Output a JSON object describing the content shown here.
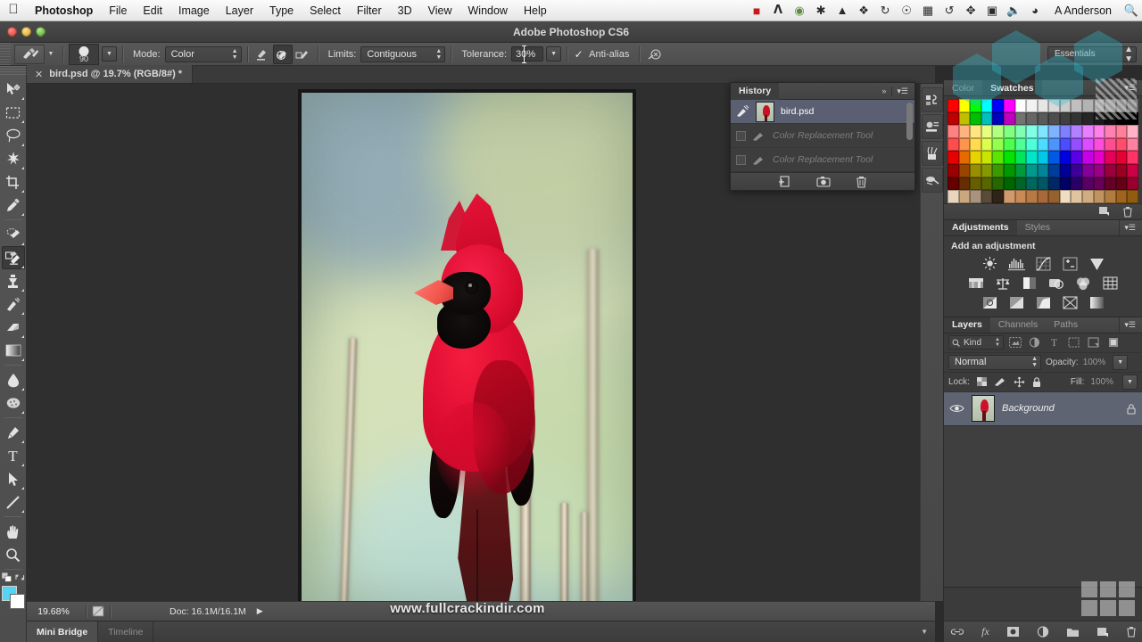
{
  "macbar": {
    "apple_icon": "apple-icon",
    "menus": [
      "Photoshop",
      "File",
      "Edit",
      "Image",
      "Layer",
      "Type",
      "Select",
      "Filter",
      "3D",
      "View",
      "Window",
      "Help"
    ],
    "status_icons": [
      "film-icon",
      "adobe-icon",
      "globe-icon",
      "asterisk-icon",
      "bell-icon",
      "dropbox-icon",
      "sync-icon",
      "accessibility-icon",
      "display-icon",
      "timemachine-icon",
      "bluetooth-icon",
      "calendar-icon",
      "volume-icon",
      "clock-icon"
    ],
    "user": "A Anderson",
    "search_icon": "search-icon"
  },
  "titlebar": {
    "title": "Adobe Photoshop CS6"
  },
  "options": {
    "tool_icon": "color-replacement-tool-icon",
    "brush_size": "90",
    "mode_label": "Mode:",
    "mode_value": "Color",
    "sampling_continuous_icon": "sampling-continuous-icon",
    "sampling_once_icon": "sampling-once-icon",
    "sampling_background_icon": "sampling-background-swatch-icon",
    "limits_label": "Limits:",
    "limits_value": "Contiguous",
    "tolerance_label": "Tolerance:",
    "tolerance_value": "30%",
    "antialias_label": "Anti-alias",
    "antialias_checked": true,
    "airbrush_icon": "airbrush-icon",
    "workspace": "Essentials"
  },
  "toolbar": {
    "tools_top": [
      "move-tool-icon",
      "rectangular-marquee-tool-icon",
      "lasso-tool-icon",
      "magic-wand-tool-icon",
      "crop-tool-icon",
      "eyedropper-tool-icon"
    ],
    "tools_mid": [
      "spot-healing-brush-tool-icon",
      "color-replacement-brush-tool-icon",
      "clone-stamp-tool-icon",
      "history-brush-tool-icon",
      "eraser-tool-icon",
      "gradient-tool-icon",
      "blur-tool-icon",
      "dodge-tool-icon"
    ],
    "tools_bottom": [
      "pen-tool-icon",
      "type-tool-icon",
      "path-selection-tool-icon",
      "line-tool-icon",
      "hand-tool-icon",
      "zoom-tool-icon"
    ],
    "selected_tool": "color-replacement-brush-tool-icon",
    "foreground_color": "#53d4f2",
    "background_color": "#ffffff"
  },
  "document": {
    "tab_label": "bird.psd @ 19.7% (RGB/8#) *",
    "close_icon": "close-icon"
  },
  "statusbar": {
    "zoom": "19.68%",
    "doc_icon": "document-proportions-icon",
    "doc_info": "Doc: 16.1M/16.1M",
    "expand_icon": "play-triangle-icon"
  },
  "bottom_tabs": [
    {
      "label": "Mini Bridge",
      "active": true
    },
    {
      "label": "Timeline",
      "active": false
    }
  ],
  "watermark": "www.fullcrackindir.com",
  "history_panel": {
    "tab": "History",
    "collapse_icon": "double-chevron-right-icon",
    "menu_icon": "panel-menu-icon",
    "items": [
      {
        "label": "bird.psd",
        "selected": true,
        "dim": false,
        "has_thumb": true
      },
      {
        "label": "Color Replacement Tool",
        "selected": false,
        "dim": true,
        "has_thumb": false
      },
      {
        "label": "Color Replacement Tool",
        "selected": false,
        "dim": true,
        "has_thumb": false
      }
    ],
    "footer_icons": [
      "new-document-from-state-icon",
      "new-snapshot-icon",
      "delete-icon"
    ]
  },
  "icon_dock": [
    "history-dock-icon",
    "properties-dock-icon",
    "brush-dock-icon",
    "clone-source-dock-icon"
  ],
  "color_panel": {
    "tabs": [
      {
        "label": "Color",
        "active": false
      },
      {
        "label": "Swatches",
        "active": true
      }
    ],
    "menu_icon": "panel-menu-icon",
    "footer_icons": [
      "new-swatch-icon",
      "delete-swatch-icon"
    ],
    "swatch_rows": [
      [
        "#ff0000",
        "#ffff00",
        "#00ff00",
        "#00ffff",
        "#0000ff",
        "#ff00ff",
        "#ffffff",
        "#f2f2f2",
        "#e6e6e6",
        "#d9d9d9",
        "#cccccc",
        "#bfbfbf",
        "#b3b3b3",
        "#a6a6a6",
        "#999999",
        "#8c8c8c",
        "#808080"
      ],
      [
        "#bf0000",
        "#bfbf00",
        "#00bf00",
        "#00bfbf",
        "#0000bf",
        "#bf00bf",
        "#737373",
        "#666666",
        "#595959",
        "#4d4d4d",
        "#404040",
        "#333333",
        "#262626",
        "#1a1a1a",
        "#0d0d0d",
        "#000000",
        "#000000"
      ],
      [
        "#ff8080",
        "#ffb380",
        "#ffe680",
        "#e6ff80",
        "#b3ff80",
        "#80ff80",
        "#80ffb3",
        "#80ffe6",
        "#80e6ff",
        "#80b3ff",
        "#8080ff",
        "#b380ff",
        "#e680ff",
        "#ff80e6",
        "#ff80b3",
        "#ff8099",
        "#ffb3c6"
      ],
      [
        "#ff4d4d",
        "#ff944d",
        "#ffdb4d",
        "#dbff4d",
        "#94ff4d",
        "#4dff4d",
        "#4dff94",
        "#4dffdb",
        "#4ddbff",
        "#4d94ff",
        "#4d4dff",
        "#944dff",
        "#db4dff",
        "#ff4ddb",
        "#ff4d94",
        "#ff4d6b",
        "#ff80a0"
      ],
      [
        "#e60000",
        "#e66a00",
        "#e6d400",
        "#c8e600",
        "#5ae600",
        "#00e600",
        "#00e65a",
        "#00e6c8",
        "#00c8e6",
        "#005ae6",
        "#0000e6",
        "#5a00e6",
        "#c800e6",
        "#e600c8",
        "#e6005a",
        "#e60033",
        "#ff3366"
      ],
      [
        "#990000",
        "#994500",
        "#998d00",
        "#859900",
        "#3c9900",
        "#009900",
        "#00993c",
        "#00998d",
        "#008599",
        "#003c99",
        "#000099",
        "#3c0099",
        "#850099",
        "#990085",
        "#99003c",
        "#990022",
        "#cc0044"
      ],
      [
        "#660000",
        "#662e00",
        "#665e00",
        "#586600",
        "#286600",
        "#006600",
        "#006628",
        "#00665e",
        "#005866",
        "#002866",
        "#000066",
        "#280066",
        "#580066",
        "#660058",
        "#660028",
        "#660017",
        "#99002e"
      ],
      [
        "#e8d5bb",
        "#c9a77f",
        "#a9937d",
        "#5a4a38",
        "#2e2418",
        "#d19a6a",
        "#c98a55",
        "#b87a45",
        "#a86a3a",
        "#96602f",
        "#f0dcc0",
        "#e0c4a0",
        "#d0ac80",
        "#c09460",
        "#b07c40",
        "#a06420",
        "#905c10"
      ]
    ]
  },
  "adjustments_panel": {
    "tabs": [
      {
        "label": "Adjustments",
        "active": true
      },
      {
        "label": "Styles",
        "active": false
      }
    ],
    "menu_icon": "panel-menu-icon",
    "title": "Add an adjustment",
    "rows": [
      [
        "brightness-contrast-icon",
        "levels-icon",
        "curves-icon",
        "exposure-icon",
        "vibrance-icon"
      ],
      [
        "hue-saturation-icon",
        "color-balance-icon",
        "black-white-icon",
        "photo-filter-icon",
        "channel-mixer-icon",
        "color-lookup-icon"
      ],
      [
        "invert-icon",
        "posterize-icon",
        "threshold-icon",
        "selective-color-icon",
        "gradient-map-icon"
      ]
    ]
  },
  "layers_panel": {
    "tabs": [
      {
        "label": "Layers",
        "active": true
      },
      {
        "label": "Channels",
        "active": false
      },
      {
        "label": "Paths",
        "active": false
      }
    ],
    "menu_icon": "panel-menu-icon",
    "filter_label": "Kind",
    "filter_search_icon": "search-icon",
    "filter_icons": [
      "filter-pixel-icon",
      "filter-adjustment-icon",
      "filter-type-icon",
      "filter-shape-icon",
      "filter-smart-object-icon",
      "filter-toggle-icon"
    ],
    "blend_mode": "Normal",
    "opacity_label": "Opacity:",
    "opacity_value": "100%",
    "lock_label": "Lock:",
    "lock_icons": [
      "lock-transparent-pixels-icon",
      "lock-image-pixels-icon",
      "lock-position-icon",
      "lock-all-icon"
    ],
    "fill_label": "Fill:",
    "fill_value": "100%",
    "layers": [
      {
        "name": "Background",
        "visible": true,
        "locked": true
      }
    ],
    "footer_icons": [
      "link-layers-icon",
      "layer-style-fx-icon",
      "add-layer-mask-icon",
      "new-fill-adjustment-icon",
      "new-group-icon",
      "new-layer-icon",
      "delete-layer-icon"
    ]
  }
}
